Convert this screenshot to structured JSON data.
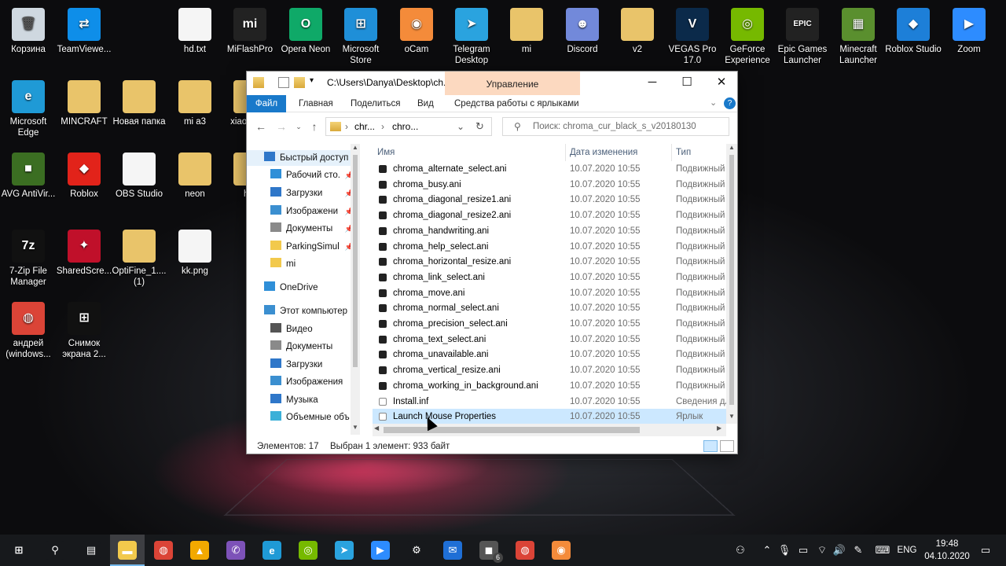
{
  "desktop": {
    "icons": [
      {
        "name": "recycle-bin-icon",
        "label": "Корзина",
        "color": "#cfd8e0",
        "glyph": "🗑"
      },
      {
        "name": "teamviewer-icon",
        "label": "TeamViewe...",
        "color": "#0e8ee9",
        "glyph": "⇄"
      },
      {
        "name": "hd-txt-icon",
        "label": "hd.txt",
        "color": "#f5f5f5",
        "glyph": ""
      },
      {
        "name": "miflashpro-icon",
        "label": "MiFlashPro",
        "color": "#222",
        "glyph": "mi"
      },
      {
        "name": "opera-neon-icon",
        "label": "Opera Neon",
        "color": "#0fa968",
        "glyph": "O"
      },
      {
        "name": "microsoft-store-icon",
        "label": "Microsoft Store",
        "color": "#1f8fd8",
        "glyph": "⊞"
      },
      {
        "name": "ocam-icon",
        "label": "oCam",
        "color": "#f48b3a",
        "glyph": "◉"
      },
      {
        "name": "telegram-desktop-icon",
        "label": "Telegram Desktop",
        "color": "#2aa3df",
        "glyph": "➤"
      },
      {
        "name": "mi-folder-icon",
        "label": "mi",
        "color": "#e9c46a",
        "glyph": ""
      },
      {
        "name": "discord-icon",
        "label": "Discord",
        "color": "#7289da",
        "glyph": "☻"
      },
      {
        "name": "v2-folder-icon",
        "label": "v2",
        "color": "#e9c46a",
        "glyph": ""
      },
      {
        "name": "vegas-pro-icon",
        "label": "VEGAS Pro 17.0",
        "color": "#0b2a4a",
        "glyph": "V"
      },
      {
        "name": "geforce-experience-icon",
        "label": "GeForce Experience",
        "color": "#76b900",
        "glyph": "◎"
      },
      {
        "name": "epic-games-launcher-icon",
        "label": "Epic Games Launcher",
        "color": "#222",
        "glyph": "EPIC"
      },
      {
        "name": "minecraft-launcher-icon",
        "label": "Minecraft Launcher",
        "color": "#5a8f2e",
        "glyph": "▦"
      },
      {
        "name": "roblox-studio-icon",
        "label": "Roblox Studio",
        "color": "#1d7fd8",
        "glyph": "◆"
      },
      {
        "name": "zoom-icon",
        "label": "Zoom",
        "color": "#2d8cff",
        "glyph": "▶"
      },
      {
        "name": "microsoft-edge-icon",
        "label": "Microsoft Edge",
        "color": "#1f9ad6",
        "glyph": "e"
      },
      {
        "name": "mincraft-folder-icon",
        "label": "MINCRAFT",
        "color": "#e9c46a",
        "glyph": ""
      },
      {
        "name": "new-folder-icon",
        "label": "Новая папка",
        "color": "#e9c46a",
        "glyph": ""
      },
      {
        "name": "mi-a3-folder-icon",
        "label": "mi a3",
        "color": "#e9c46a",
        "glyph": ""
      },
      {
        "name": "xiaomi-folder-icon",
        "label": "xiao... p...",
        "color": "#e9c46a",
        "glyph": ""
      },
      {
        "name": "avg-antivirus-icon",
        "label": "AVG AntiVir...",
        "color": "#3b6e22",
        "glyph": "■"
      },
      {
        "name": "roblox-icon",
        "label": "Roblox",
        "color": "#e2231a",
        "glyph": "◆"
      },
      {
        "name": "obs-studio-icon",
        "label": "OBS Studio",
        "color": "#f5f5f5",
        "glyph": ""
      },
      {
        "name": "neon-folder-icon",
        "label": "neon",
        "color": "#e9c46a",
        "glyph": ""
      },
      {
        "name": "h-folder-icon",
        "label": "h...",
        "color": "#e9c46a",
        "glyph": ""
      },
      {
        "name": "7zip-file-manager-icon",
        "label": "7-Zip File Manager",
        "color": "#111",
        "glyph": "7z"
      },
      {
        "name": "sharedscreen-icon",
        "label": "SharedScre...",
        "color": "#c0102a",
        "glyph": "✦"
      },
      {
        "name": "optifine-folder-icon",
        "label": "OptiFine_1.... (1)",
        "color": "#e9c46a",
        "glyph": ""
      },
      {
        "name": "kk-png-icon",
        "label": "kk.png",
        "color": "#f5f5f5",
        "glyph": ""
      },
      {
        "name": "chrome-user-icon",
        "label": "андрей (windows...",
        "color": "#db4437",
        "glyph": "◍"
      },
      {
        "name": "screenshot-icon",
        "label": "Снимок экрана 2...",
        "color": "#111",
        "glyph": "⊞"
      }
    ]
  },
  "explorer": {
    "title_path": "C:\\Users\\Danya\\Desktop\\ch...",
    "manage_tab": "Управление",
    "ribbon_tabs": [
      "Файл",
      "Главная",
      "Поделиться",
      "Вид",
      "Средства работы с ярлыками"
    ],
    "breadcrumb": [
      "chr...",
      "chro..."
    ],
    "search_placeholder": "Поиск: chroma_cur_black_s_v20180130",
    "nav_items": [
      {
        "label": "Быстрый доступ",
        "color": "#2f77c9",
        "pinned": false,
        "selected": true
      },
      {
        "label": "Рабочий сто.",
        "color": "#2f8fd8",
        "pinned": true,
        "selected": false
      },
      {
        "label": "Загрузки",
        "color": "#2f77c9",
        "pinned": true,
        "selected": false
      },
      {
        "label": "Изображени",
        "color": "#3b8fd0",
        "pinned": true,
        "selected": false
      },
      {
        "label": "Документы",
        "color": "#8a8a8a",
        "pinned": true,
        "selected": false
      },
      {
        "label": "ParkingSimul",
        "color": "#f2c94c",
        "pinned": true,
        "selected": false
      },
      {
        "label": "mi",
        "color": "#f2c94c",
        "pinned": false,
        "selected": false
      },
      {
        "label": "OneDrive",
        "color": "#2f8fd8",
        "pinned": false,
        "selected": false
      },
      {
        "label": "Этот компьютер",
        "color": "#3b8fd0",
        "pinned": false,
        "selected": false
      },
      {
        "label": "Видео",
        "color": "#555",
        "pinned": false,
        "selected": false
      },
      {
        "label": "Документы",
        "color": "#8a8a8a",
        "pinned": false,
        "selected": false
      },
      {
        "label": "Загрузки",
        "color": "#2f77c9",
        "pinned": false,
        "selected": false
      },
      {
        "label": "Изображения",
        "color": "#3b8fd0",
        "pinned": false,
        "selected": false
      },
      {
        "label": "Музыка",
        "color": "#2f77c9",
        "pinned": false,
        "selected": false
      },
      {
        "label": "Объемные объ",
        "color": "#3bb0d8",
        "pinned": false,
        "selected": false
      }
    ],
    "columns": {
      "name": "Имя",
      "date": "Дата изменения",
      "type": "Тип"
    },
    "files": [
      {
        "name": "chroma_alternate_select.ani",
        "date": "10.07.2020 10:55",
        "type": "Подвижный",
        "kind": "cursor"
      },
      {
        "name": "chroma_busy.ani",
        "date": "10.07.2020 10:55",
        "type": "Подвижный",
        "kind": "cursor"
      },
      {
        "name": "chroma_diagonal_resize1.ani",
        "date": "10.07.2020 10:55",
        "type": "Подвижный",
        "kind": "cursor"
      },
      {
        "name": "chroma_diagonal_resize2.ani",
        "date": "10.07.2020 10:55",
        "type": "Подвижный",
        "kind": "cursor"
      },
      {
        "name": "chroma_handwriting.ani",
        "date": "10.07.2020 10:55",
        "type": "Подвижный",
        "kind": "cursor"
      },
      {
        "name": "chroma_help_select.ani",
        "date": "10.07.2020 10:55",
        "type": "Подвижный",
        "kind": "cursor"
      },
      {
        "name": "chroma_horizontal_resize.ani",
        "date": "10.07.2020 10:55",
        "type": "Подвижный",
        "kind": "cursor"
      },
      {
        "name": "chroma_link_select.ani",
        "date": "10.07.2020 10:55",
        "type": "Подвижный",
        "kind": "cursor"
      },
      {
        "name": "chroma_move.ani",
        "date": "10.07.2020 10:55",
        "type": "Подвижный",
        "kind": "cursor"
      },
      {
        "name": "chroma_normal_select.ani",
        "date": "10.07.2020 10:55",
        "type": "Подвижный",
        "kind": "cursor"
      },
      {
        "name": "chroma_precision_select.ani",
        "date": "10.07.2020 10:55",
        "type": "Подвижный",
        "kind": "cursor"
      },
      {
        "name": "chroma_text_select.ani",
        "date": "10.07.2020 10:55",
        "type": "Подвижный",
        "kind": "cursor"
      },
      {
        "name": "chroma_unavailable.ani",
        "date": "10.07.2020 10:55",
        "type": "Подвижный",
        "kind": "cursor"
      },
      {
        "name": "chroma_vertical_resize.ani",
        "date": "10.07.2020 10:55",
        "type": "Подвижный",
        "kind": "cursor"
      },
      {
        "name": "chroma_working_in_background.ani",
        "date": "10.07.2020 10:55",
        "type": "Подвижный",
        "kind": "cursor"
      },
      {
        "name": "Install.inf",
        "date": "10.07.2020 10:55",
        "type": "Сведения дл",
        "kind": "config"
      },
      {
        "name": "Launch Mouse Properties",
        "date": "10.07.2020 10:55",
        "type": "Ярлык",
        "kind": "shortcut",
        "selected": true
      }
    ],
    "status_count": "Элементов: 17",
    "status_selected": "Выбран 1 элемент: 933 байт"
  },
  "taskbar": {
    "icons": [
      {
        "name": "start-button-icon",
        "glyph": "⊞",
        "color": "#17191c"
      },
      {
        "name": "search-icon",
        "glyph": "⚲",
        "color": "#17191c"
      },
      {
        "name": "task-view-icon",
        "glyph": "▤",
        "color": "#17191c"
      },
      {
        "name": "file-explorer-icon",
        "glyph": "▬",
        "color": "#f2c94c",
        "active": true
      },
      {
        "name": "chrome-icon",
        "glyph": "◍",
        "color": "#db4437"
      },
      {
        "name": "avast-icon",
        "glyph": "▲",
        "color": "#f2a900"
      },
      {
        "name": "viber-icon",
        "glyph": "✆",
        "color": "#7d52b8"
      },
      {
        "name": "edge-icon",
        "glyph": "e",
        "color": "#1f9ad6"
      },
      {
        "name": "nvidia-icon",
        "glyph": "◎",
        "color": "#76b900"
      },
      {
        "name": "telegram-icon",
        "glyph": "➤",
        "color": "#2aa3df"
      },
      {
        "name": "zoom-taskbar-icon",
        "glyph": "▶",
        "color": "#2d8cff"
      },
      {
        "name": "settings-icon",
        "glyph": "⚙",
        "color": "#17191c"
      },
      {
        "name": "mail-icon",
        "glyph": "✉",
        "color": "#1f6fd6"
      },
      {
        "name": "unknown-app-icon",
        "glyph": "◼",
        "color": "#555",
        "badge": "6"
      },
      {
        "name": "chrome-user-taskbar-icon",
        "glyph": "◍",
        "color": "#db4437"
      },
      {
        "name": "ocam-taskbar-icon",
        "glyph": "◉",
        "color": "#f48b3a"
      }
    ],
    "language": "ENG",
    "time": "19:48",
    "date": "04.10.2020"
  }
}
